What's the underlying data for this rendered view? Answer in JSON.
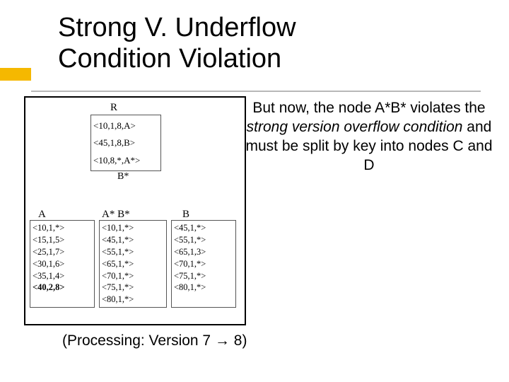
{
  "title_line1": "Strong V. Underflow",
  "title_line2": "Condition Violation",
  "body": {
    "pre": "But now, the node A*B* violates the ",
    "italic": "strong version overflow condition",
    "post": " and must be split by key into nodes C and D"
  },
  "diagram": {
    "root_label": "R",
    "root_entries": [
      "<10,1,8,A>",
      "<45,1,8,B>",
      "<10,8,*,A*>"
    ],
    "bstar_label": "B*",
    "leaf_labels": {
      "A": "A",
      "AB": "A* B*",
      "B": "B"
    },
    "leaf_A": [
      "<10,1,*>",
      "<15,1,5>",
      "<25,1,7>",
      "<30,1,6>",
      "<35,1,4>",
      "<40,2,8>"
    ],
    "leaf_AB": [
      "<10,1,*>",
      "<45,1,*>",
      "<55,1,*>",
      "<65,1,*>",
      "<70,1,*>",
      "<75,1,*>",
      "<80,1,*>"
    ],
    "leaf_B": [
      "<45,1,*>",
      "<55,1,*>",
      "<65,1,3>",
      "<70,1,*>",
      "<75,1,*>",
      "<80,1,*>"
    ]
  },
  "caption": {
    "pre": "(Processing: Version 7",
    "arrow": " → ",
    "post": "8)"
  }
}
